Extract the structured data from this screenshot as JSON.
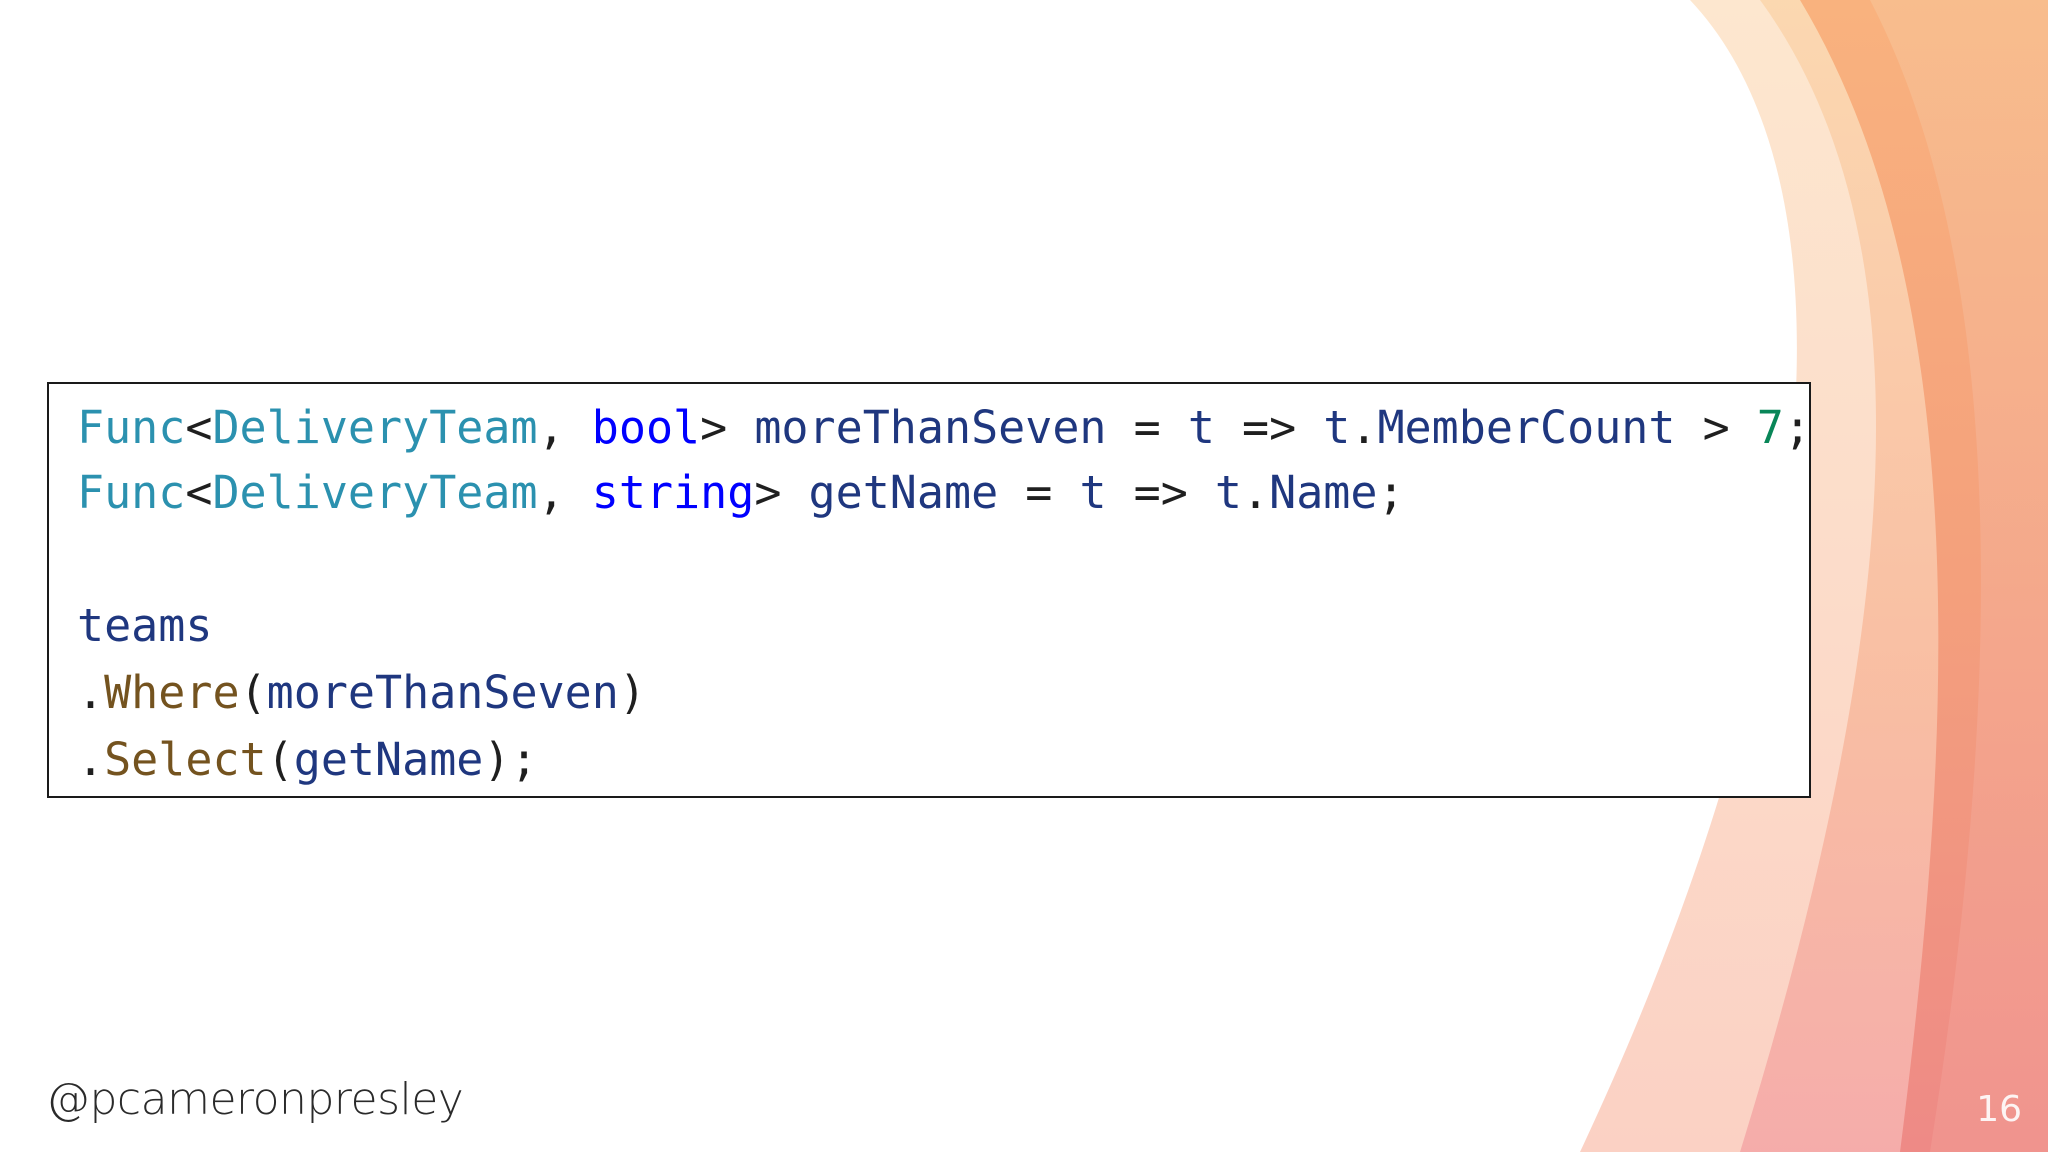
{
  "slide": {
    "handle": "@pcameronpresley",
    "page_number": "16"
  },
  "code": {
    "line1": {
      "t1": "Func",
      "t2": "<",
      "t3": "DeliveryTeam",
      "t4": ", ",
      "t5": "bool",
      "t6": "> ",
      "t7": "moreThanSeven",
      "t8": " = ",
      "t9": "t",
      "t10": " => ",
      "t11": "t",
      "t12": ".",
      "t13": "MemberCount",
      "t14": " > ",
      "t15": "7",
      "t16": ";"
    },
    "line2": {
      "t1": "Func",
      "t2": "<",
      "t3": "DeliveryTeam",
      "t4": ", ",
      "t5": "string",
      "t6": "> ",
      "t7": "getName",
      "t8": " = ",
      "t9": "t",
      "t10": " => ",
      "t11": "t",
      "t12": ".",
      "t13": "Name",
      "t14": ";"
    },
    "line3": {
      "t1": "teams"
    },
    "line4": {
      "t1": ".",
      "t2": "Where",
      "t3": "(",
      "t4": "moreThanSeven",
      "t5": ")"
    },
    "line5": {
      "t1": ".",
      "t2": "Select",
      "t3": "(",
      "t4": "getName",
      "t5": ");"
    }
  },
  "colors": {
    "type": "#2b91af",
    "keyword": "#0000ff",
    "identifier": "#1f377f",
    "method": "#74531f",
    "number": "#098658",
    "decor_orange": "#f7b27a",
    "decor_pink": "#f08f8f"
  }
}
